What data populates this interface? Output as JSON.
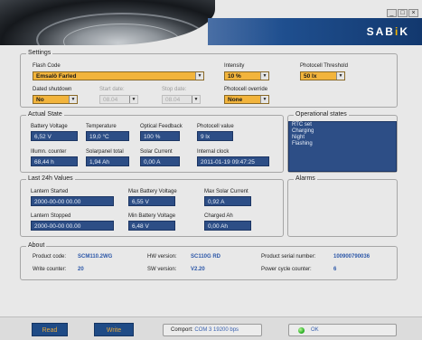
{
  "brand": {
    "logo_main": "SAB",
    "logo_accent": "K",
    "logo_sep": "i"
  },
  "window_controls": [
    "_",
    "□",
    "×"
  ],
  "settings": {
    "legend": "Settings",
    "flash_code": {
      "label": "Flash Code",
      "value": "Emsalö Farled"
    },
    "intensity": {
      "label": "Intensity",
      "value": "10 %"
    },
    "photocell_threshold": {
      "label": "Photocell Threshold",
      "value": "50 lx"
    },
    "dated_shutdown": {
      "label": "Dated shutdown",
      "value": "No"
    },
    "start_date": {
      "label": "Start date:",
      "value": "08.04"
    },
    "stop_date": {
      "label": "Stop date:",
      "value": "08.04"
    },
    "photocell_override": {
      "label": "Photocell override",
      "value": "None"
    }
  },
  "actual_state": {
    "legend": "Actual State",
    "fields": [
      {
        "label": "Battery Voltage",
        "value": "6,52 V"
      },
      {
        "label": "Temperature",
        "value": "19,0 °C"
      },
      {
        "label": "Optical Feedback",
        "value": "100 %"
      },
      {
        "label": "Photocell value",
        "value": "9 lx"
      },
      {
        "label": "Illumn. counter",
        "value": "68,44 h"
      },
      {
        "label": "Solarpanel total",
        "value": "1,94 Ah"
      },
      {
        "label": "Solar Current",
        "value": "0,00 A"
      },
      {
        "label": "Internal clock",
        "value": "2011-01-19     09:47:25"
      }
    ]
  },
  "operational_states": {
    "legend": "Operational states",
    "items": [
      "RTC set",
      "Charging",
      "Night",
      "Flashing"
    ]
  },
  "last24h": {
    "legend": "Last 24h Values",
    "fields": [
      {
        "label": "Lantern Started",
        "value": "2000-00-00     00.00"
      },
      {
        "label": "Max Battery Voltage",
        "value": "6,55 V"
      },
      {
        "label": "Max Solar Current",
        "value": "0,92 A"
      },
      {
        "label": "Lantern Stopped",
        "value": "2000-00-00     00.00"
      },
      {
        "label": "Min Battery Voltage",
        "value": "6,48 V"
      },
      {
        "label": "Charged Ah",
        "value": "0,00 Ah"
      }
    ]
  },
  "alarms": {
    "legend": "Alarms"
  },
  "about": {
    "legend": "About",
    "product_code": {
      "label": "Product code:",
      "value": "SCM110.2WG"
    },
    "hw_version": {
      "label": "HW version:",
      "value": "SC110G RD"
    },
    "serial": {
      "label": "Product serial number:",
      "value": "100900790036"
    },
    "write_counter": {
      "label": "Write counter:",
      "value": "20"
    },
    "sw_version": {
      "label": "SW version:",
      "value": "V2.20"
    },
    "power_cycle": {
      "label": "Power cycle counter:",
      "value": "6"
    }
  },
  "footer": {
    "read_label": "Read",
    "write_label": "Write",
    "comport_label": "Comport:",
    "comport_value": "COM 3    19200 bps",
    "status_label": "OK"
  },
  "colors": {
    "field_bg": "#2d4e86",
    "combo_bg": "#f2b43c",
    "brand_blue": "#12386e",
    "status_green": "#2fb52a"
  }
}
